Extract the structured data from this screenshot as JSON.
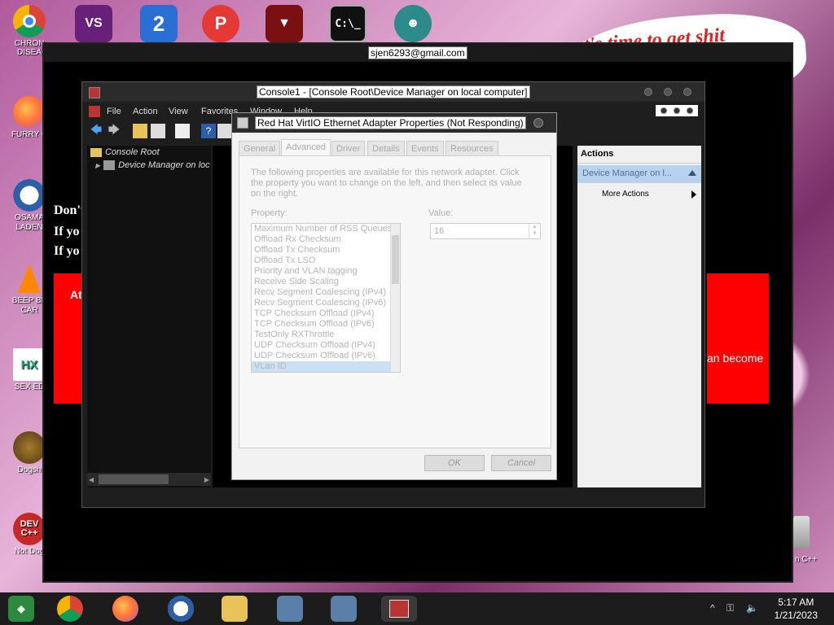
{
  "desktop": {
    "icons": [
      {
        "label": "CHRON DISEA",
        "icon": "chrome-icon"
      },
      {
        "label": "FURRY C",
        "icon": "firefox-icon"
      },
      {
        "label": "OSAMA LADEN",
        "icon": "obama-logo-icon"
      },
      {
        "label": "BEEP BE CAR",
        "icon": "vlc-cone-icon"
      },
      {
        "label": "SEX ED",
        "icon": "hx-icon"
      },
      {
        "label": "Dogsh",
        "icon": "dogshit-icon"
      },
      {
        "label": "Not Dog",
        "icon": "devcpp-icon"
      }
    ],
    "top_icons": [
      "visual-studio-icon",
      "number-2-icon",
      "p-icon",
      "bat-icon",
      "cmd-icon",
      "santa-icon"
    ],
    "right_labels": [
      "n C++"
    ],
    "banner_text": "it's time to get shit",
    "banner_fragment": "te"
  },
  "outer_window": {
    "title": "sjen6293@gmail.com",
    "text_lines": [
      "Don't",
      "If yo",
      "If yo"
    ],
    "red_left_text": "At",
    "red_right_text": "an become"
  },
  "mmc": {
    "title": "Console1 - [Console Root\\Device Manager on local computer]",
    "menu": [
      "File",
      "Action",
      "View",
      "Favorites",
      "Window",
      "Help"
    ],
    "tree": {
      "root": "Console Root",
      "child": "Device Manager on loc"
    },
    "actions": {
      "header": "Actions",
      "selected": "Device Manager on l...",
      "more": "More Actions"
    }
  },
  "dialog": {
    "title": "Red Hat VirtIO Ethernet Adapter Properties (Not Responding)",
    "tabs": [
      "General",
      "Advanced",
      "Driver",
      "Details",
      "Events",
      "Resources"
    ],
    "active_tab": "Advanced",
    "description": "The following properties are available for this network adapter. Click the property you want to change on the left, and then select its value on the right.",
    "property_label": "Property:",
    "value_label": "Value:",
    "value": "16",
    "properties": [
      "Maximum Number of RSS Queues",
      "Offload Rx Checksum",
      "Offload Tx Checksum",
      "Offload Tx LSO",
      "Priority and VLAN tagging",
      "Receive Side Scaling",
      "Recv Segment Coalescing (IPv4)",
      "Recv Segment Coalescing (IPv6)",
      "TCP Checksum Offload (IPv4)",
      "TCP Checksum Offload (IPv6)",
      "TestOnly RXThrottle",
      "UDP Checksum Offload (IPv4)",
      "UDP Checksum Offload (IPv6)",
      "VLan ID"
    ],
    "selected_property": "VLan ID",
    "ok_label": "OK",
    "cancel_label": "Cancel"
  },
  "taskbar": {
    "items": [
      "start-icon",
      "chrome-icon",
      "firefox-icon",
      "obama-icon",
      "file-explorer-icon",
      "network-icon",
      "network-icon-2",
      "mmc-icon"
    ],
    "time": "5:17 AM",
    "date": "1/21/2023"
  }
}
